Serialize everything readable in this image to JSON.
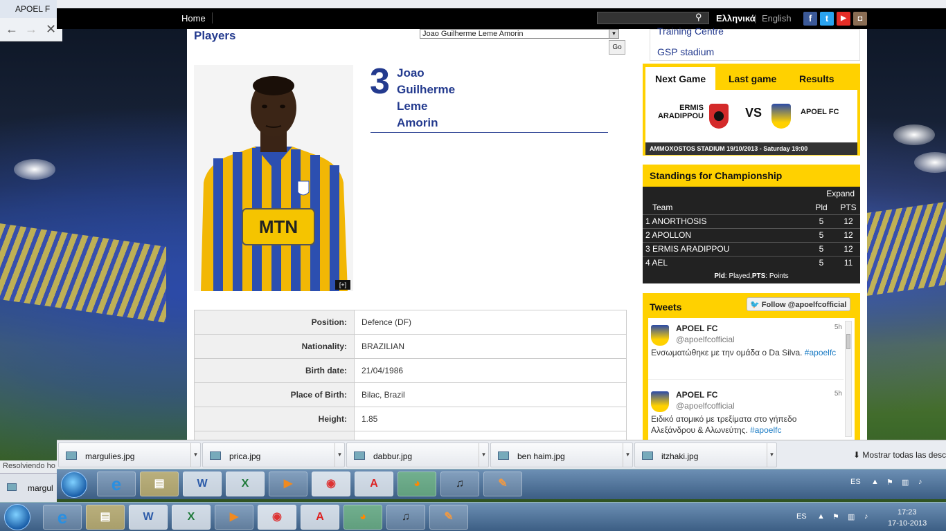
{
  "back_window": {
    "tab_title": "APOEL F",
    "status": "Resolviendo ho",
    "taskbar_label": "margul"
  },
  "site": {
    "nav_home": "Home",
    "lang_greek": "Ελληνικά",
    "lang_sep": "|",
    "lang_english": "English",
    "social": [
      "f",
      "t",
      "▶",
      "◘"
    ]
  },
  "player_page": {
    "section_title": "Players",
    "selected_player": "Joao Guilherme Leme Amorin",
    "go_label": "Go",
    "enlarge_label": "[+]",
    "number": "3",
    "name_lines": [
      "Joao",
      "Guilherme",
      "Leme",
      "Amorin"
    ],
    "jersey_sponsor": "MTN",
    "info": [
      {
        "key": "Position:",
        "value": "Defence (DF)"
      },
      {
        "key": "Nationality:",
        "value": "BRAZILIAN"
      },
      {
        "key": "Birth date:",
        "value": "21/04/1986"
      },
      {
        "key": "Place of Birth:",
        "value": "Bilac, Brazil"
      },
      {
        "key": "Height:",
        "value": "1.85"
      }
    ]
  },
  "sidebar": {
    "links": [
      "Training Centre",
      "GSP stadium"
    ],
    "next_game": {
      "tabs": [
        "Next Game",
        "Last game",
        "Results"
      ],
      "home_team": "ERMIS ARADIPPOU",
      "vs": "VS",
      "away_team": "APOEL FC",
      "venue": "AMMOXOSTOS STADIUM 19/10/2013 - Saturday 19:00"
    },
    "standings": {
      "title": "Standings for Championship",
      "expand": "Expand",
      "headers": [
        "Team",
        "Pld",
        "PTS"
      ],
      "rows": [
        {
          "team": "1 ANORTHOSIS",
          "pld": "5",
          "pts": "12"
        },
        {
          "team": "2 APOLLON",
          "pld": "5",
          "pts": "12"
        },
        {
          "team": "3 ERMIS ARADIPPOU",
          "pld": "5",
          "pts": "12"
        },
        {
          "team": "4 AEL",
          "pld": "5",
          "pts": "11"
        }
      ],
      "legend_pld": "Pld",
      "legend_text": ": Played,",
      "legend_pts": "PTS",
      "legend_text2": ": Points"
    },
    "tweets": {
      "title": "Tweets",
      "follow": "Follow @apoelfcofficial",
      "items": [
        {
          "name": "APOEL FC",
          "handle": "@apoelfcofficial",
          "time": "5h",
          "text": "Ενσωματώθηκε με την ομάδα ο Da Silva.",
          "hashtag": "#apoelfc"
        },
        {
          "name": "APOEL FC",
          "handle": "@apoelfcofficial",
          "time": "5h",
          "text": "Ειδικό ατομικό με τρεξίματα στο γήπεδο Αλεξάνδρου & Αλωνεύτης.",
          "hashtag": "#apoelfc"
        }
      ]
    }
  },
  "downloads": {
    "files": [
      "margulies.jpg",
      "prica.jpg",
      "dabbur.jpg",
      "ben haim.jpg",
      "itzhaki.jpg"
    ],
    "show_all": "Mostrar todas las desc"
  },
  "taskbar": {
    "lang": "ES",
    "time": "17:23",
    "date": "17-10-2013"
  },
  "colors": {
    "brand_blue": "#233a8e",
    "brand_yellow": "#ffd100",
    "dark_panel": "#222222"
  }
}
